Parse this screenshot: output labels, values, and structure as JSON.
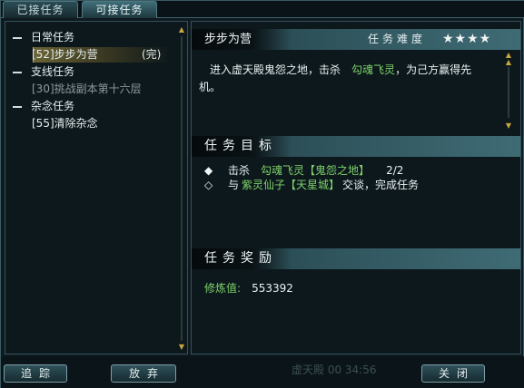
{
  "tabs": [
    {
      "label": "已接任务"
    },
    {
      "label": "可接任务"
    }
  ],
  "quest_list": {
    "categories": [
      {
        "label": "日常任务",
        "items": [
          {
            "text": "[52]步步为营",
            "tag": "(完)",
            "selected": true
          }
        ]
      },
      {
        "label": "支线任务",
        "items": [
          {
            "text": "[30]挑战副本第十六层",
            "tag": "",
            "dim": true
          }
        ]
      },
      {
        "label": "杂念任务",
        "items": [
          {
            "text": "[55]清除杂念",
            "tag": ""
          }
        ]
      }
    ]
  },
  "detail": {
    "title": "步步为营",
    "difficulty_label": "任务难度",
    "difficulty_stars": "★★★★",
    "description_pre": "进入虚天殿鬼怨之地，击杀",
    "description_target": "勾魂飞灵",
    "description_post1": "，为己方赢得先",
    "description_post2": "机。"
  },
  "objectives": {
    "header": "任务目标",
    "items": [
      {
        "bullet": "◆",
        "verb": "击杀",
        "target": "勾魂飞灵【鬼怨之地】",
        "progress": "2/2"
      },
      {
        "bullet": "◇",
        "verb": "与",
        "target": "紫灵仙子【天星城】",
        "suffix": "交谈，完成任务"
      }
    ]
  },
  "rewards": {
    "header": "任务奖励",
    "label": "修炼值:",
    "value": "553392"
  },
  "buttons": {
    "track": "追踪",
    "abandon": "放弃",
    "close": "关闭"
  },
  "background_text": "虚天殿 00 34:56"
}
